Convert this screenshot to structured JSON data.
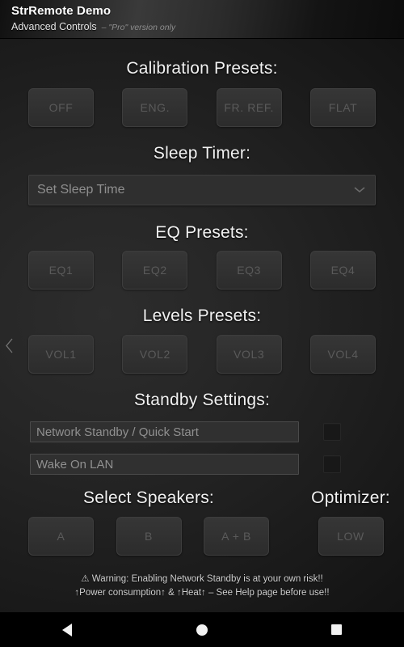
{
  "header": {
    "title": "StrRemote Demo",
    "subtitle": "Advanced Controls",
    "subtitle_note": "– \"Pro\" version only"
  },
  "sections": {
    "calibration": {
      "title": "Calibration Presets:",
      "buttons": [
        {
          "label": "OFF"
        },
        {
          "label": "ENG."
        },
        {
          "label": "FR. REF."
        },
        {
          "label": "FLAT"
        }
      ]
    },
    "sleep_timer": {
      "title": "Sleep Timer:",
      "spinner_value": "Set Sleep Time",
      "caret_icon": "chevron-down-icon"
    },
    "eq_presets": {
      "title": "EQ Presets:",
      "buttons": [
        {
          "label": "EQ1"
        },
        {
          "label": "EQ2"
        },
        {
          "label": "EQ3"
        },
        {
          "label": "EQ4"
        }
      ]
    },
    "levels_presets": {
      "title": "Levels Presets:",
      "buttons": [
        {
          "label": "VOL1"
        },
        {
          "label": "VOL2"
        },
        {
          "label": "VOL3"
        },
        {
          "label": "VOL4"
        }
      ]
    },
    "standby": {
      "title": "Standby Settings:",
      "rows": [
        {
          "label": "Network Standby / Quick Start",
          "checked": false
        },
        {
          "label": "Wake On LAN",
          "checked": false
        }
      ]
    },
    "speakers": {
      "title": "Select Speakers:",
      "buttons": [
        {
          "label": "A"
        },
        {
          "label": "B"
        },
        {
          "label": "A + B"
        }
      ]
    },
    "optimizer": {
      "title": "Optimizer:",
      "buttons": [
        {
          "label": "LOW"
        }
      ]
    }
  },
  "warning": {
    "line1": "⚠ Warning: Enabling Network Standby is at your own risk!!",
    "line2": "↑Power consumption↑ & ↑Heat↑ – See Help page before use!!"
  },
  "edge_nav": {
    "prev_icon": "chevron-left-icon"
  },
  "navbar": {
    "back": "back-triangle-icon",
    "home": "home-circle-icon",
    "recents": "recents-square-icon"
  },
  "colors": {
    "background": "#1a1a1a",
    "header_text": "#ffffff",
    "section_title": "#f2f2f2",
    "button_face": "#313131",
    "button_text_disabled": "#5a5a5a",
    "warning_text": "#cfcfcf"
  }
}
